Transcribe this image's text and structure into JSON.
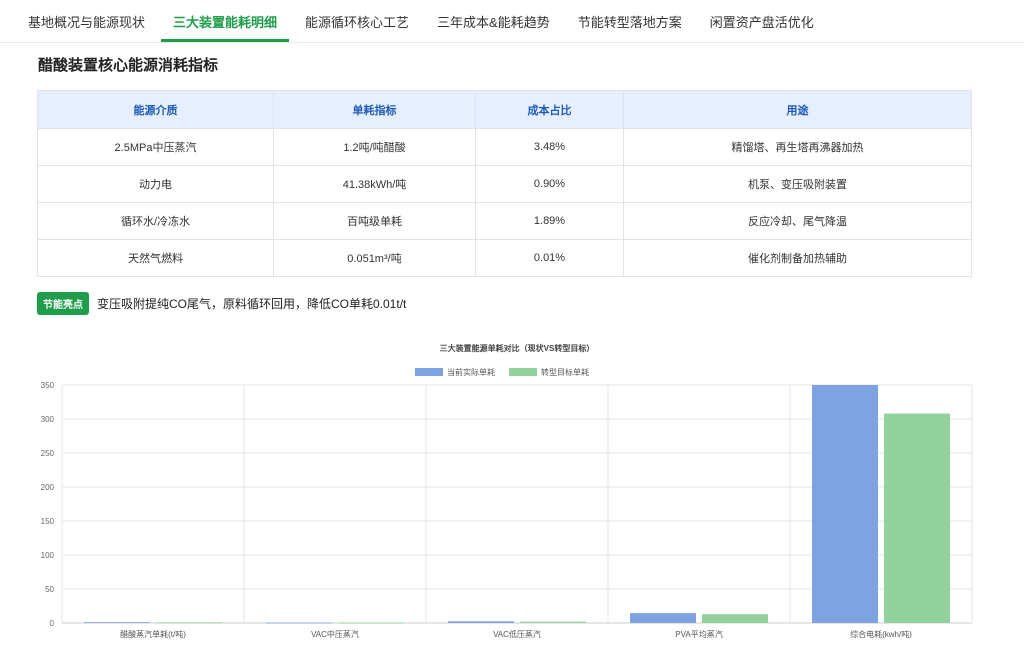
{
  "tabs": [
    {
      "label": "基地概况与能源现状",
      "active": false
    },
    {
      "label": "三大装置能耗明细",
      "active": true
    },
    {
      "label": "能源循环核心工艺",
      "active": false
    },
    {
      "label": "三年成本&能耗趋势",
      "active": false
    },
    {
      "label": "节能转型落地方案",
      "active": false
    },
    {
      "label": "闲置资产盘活优化",
      "active": false
    }
  ],
  "section_title": "醋酸装置核心能源消耗指标",
  "table": {
    "headers": [
      "能源介质",
      "单耗指标",
      "成本占比",
      "用途"
    ],
    "rows": [
      [
        "2.5MPa中压蒸汽",
        "1.2吨/吨醋酸",
        "3.48%",
        "精馏塔、再生塔再沸器加热"
      ],
      [
        "动力电",
        "41.38kWh/吨",
        "0.90%",
        "机泵、变压吸附装置"
      ],
      [
        "循环水/冷冻水",
        "百吨级单耗",
        "1.89%",
        "反应冷却、尾气降温"
      ],
      [
        "天然气燃料",
        "0.051m³/吨",
        "0.01%",
        "催化剂制备加热辅助"
      ]
    ]
  },
  "highlight": {
    "badge": "节能亮点",
    "text": "变压吸附提纯CO尾气，原料循环回用，降低CO单耗0.01t/t"
  },
  "chart_data": {
    "type": "bar",
    "title": "三大装置能源单耗对比（现状VS转型目标）",
    "categories": [
      "醋酸蒸汽单耗(t/吨)",
      "VAC中压蒸汽",
      "VAC低压蒸汽",
      "PVA平均蒸汽",
      "综合电耗(kwh/吨)"
    ],
    "series": [
      {
        "name": "当前实际单耗",
        "color": "#7ea3e0",
        "values": [
          1.2,
          0.5,
          2.5,
          14.5,
          350
        ]
      },
      {
        "name": "转型目标单耗",
        "color": "#93d19e",
        "values": [
          1.0,
          0.4,
          2.0,
          13.0,
          308
        ]
      }
    ],
    "ylim": [
      0,
      350
    ],
    "yticks": [
      0,
      50,
      100,
      150,
      200,
      250,
      300,
      350
    ],
    "grid": true,
    "legend": "top-center"
  }
}
